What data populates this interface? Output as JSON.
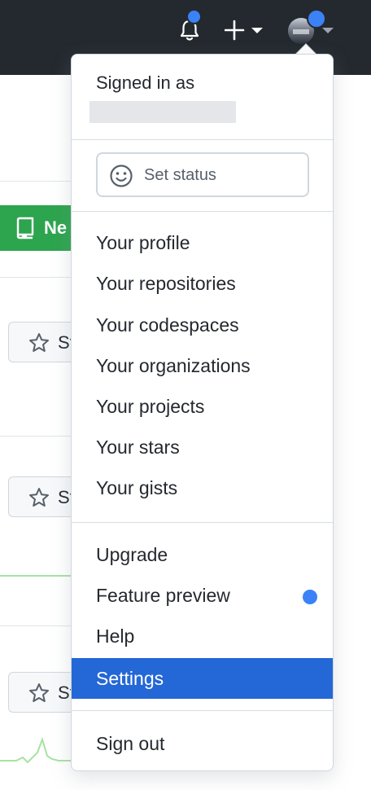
{
  "header": {
    "icons": [
      "bell-icon",
      "plus-icon",
      "caret-down-icon",
      "avatar"
    ],
    "notification_color": "#3b82f6"
  },
  "background": {
    "new_button_label": "Ne",
    "star_button_label": "St"
  },
  "dropdown": {
    "signed_in_label": "Signed in as",
    "status": {
      "label": "Set status",
      "icon": "smiley-icon"
    },
    "profile_items": [
      "Your profile",
      "Your repositories",
      "Your codespaces",
      "Your organizations",
      "Your projects",
      "Your stars",
      "Your gists"
    ],
    "support_items": [
      "Upgrade",
      "Feature preview",
      "Help",
      "Settings"
    ],
    "active_item": "Settings",
    "sign_out_label": "Sign out",
    "colors": {
      "active_bg": "#2467d6",
      "accent": "#3b82f6",
      "green": "#2da44e"
    }
  }
}
